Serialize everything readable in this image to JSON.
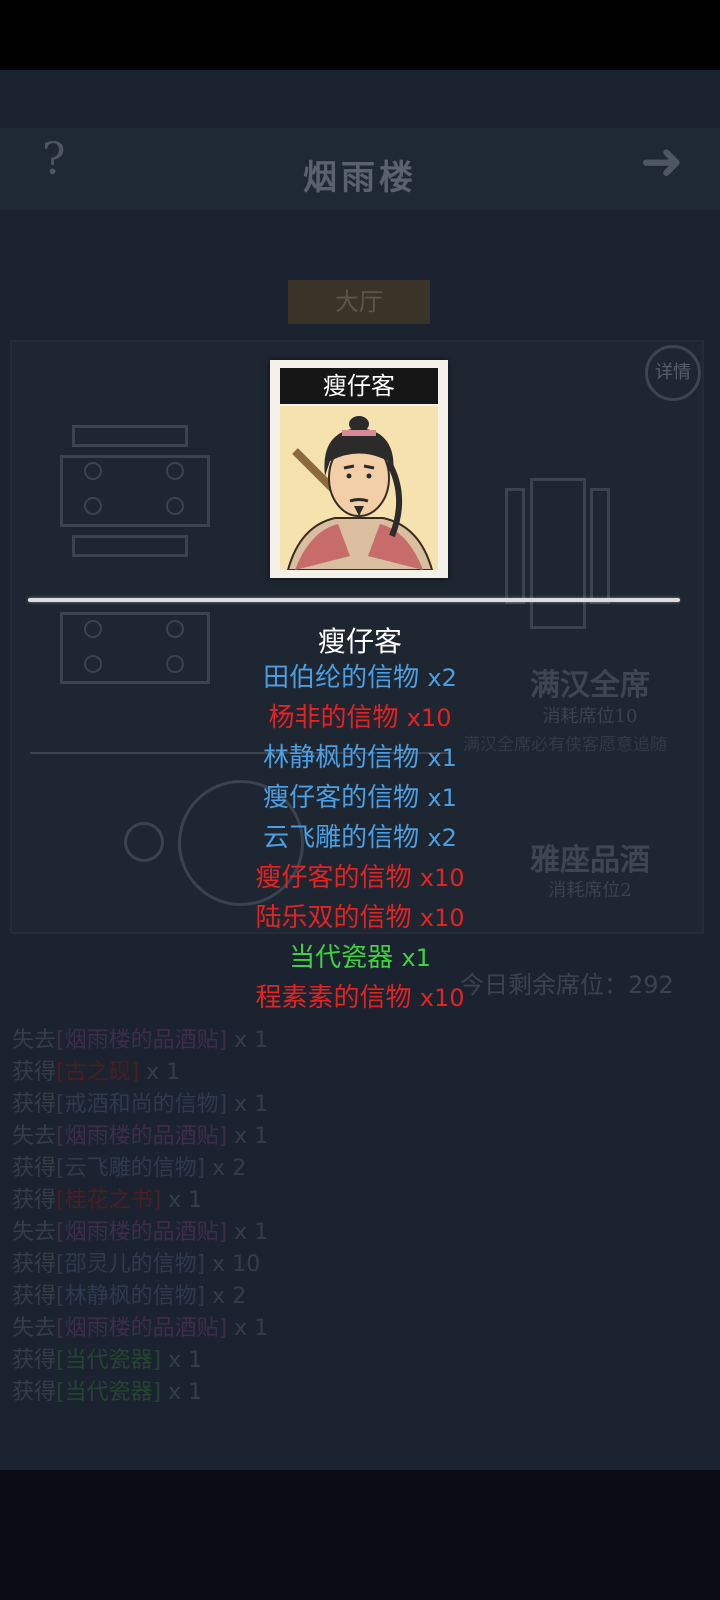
{
  "header": {
    "title": "烟雨楼",
    "help_icon": "?",
    "next_icon": "right-arrow-icon"
  },
  "tab": {
    "label": "大厅"
  },
  "detail": {
    "label": "详情"
  },
  "options": [
    {
      "title": "满汉全席",
      "cost": "消耗席位10",
      "desc": "满汉全席必有侠客愿意追随"
    },
    {
      "title": "雅座品酒",
      "cost": "消耗席位2"
    }
  ],
  "remaining": "今日剩余席位：292",
  "log": [
    {
      "verb": "失去",
      "item": "[烟雨楼的品酒贴]",
      "qty": " x 1",
      "tone": "pur"
    },
    {
      "verb": "获得",
      "item": "[古之砚]",
      "qty": " x 1",
      "tone": "red"
    },
    {
      "verb": "获得",
      "item": "[戒酒和尚的信物]",
      "qty": " x 1",
      "tone": "blue"
    },
    {
      "verb": "失去",
      "item": "[烟雨楼的品酒贴]",
      "qty": " x 1",
      "tone": "pur"
    },
    {
      "verb": "获得",
      "item": "[云飞雕的信物]",
      "qty": " x 2",
      "tone": "blue"
    },
    {
      "verb": "获得",
      "item": "[桂花之书]",
      "qty": " x 1",
      "tone": "red"
    },
    {
      "verb": "失去",
      "item": "[烟雨楼的品酒贴]",
      "qty": " x 1",
      "tone": "pur"
    },
    {
      "verb": "获得",
      "item": "[邵灵儿的信物]",
      "qty": " x 10",
      "tone": "blue"
    },
    {
      "verb": "获得",
      "item": "[林静枫的信物]",
      "qty": " x 2",
      "tone": "blue"
    },
    {
      "verb": "失去",
      "item": "[烟雨楼的品酒贴]",
      "qty": " x 1",
      "tone": "pur"
    },
    {
      "verb": "获得",
      "item": "[当代瓷器]",
      "qty": " x 1",
      "tone": "grn"
    },
    {
      "verb": "获得",
      "item": "[当代瓷器]",
      "qty": " x 1",
      "tone": "grn"
    }
  ],
  "popup": {
    "card_name": "瘦仔客",
    "title": "瘦仔客",
    "colors": {
      "blue": "#4a9fe3",
      "red": "#e52222",
      "green": "#3fd13f"
    },
    "rewards": [
      {
        "name": "田伯纶的信物",
        "qty": "x2",
        "color": "blue"
      },
      {
        "name": "杨非的信物",
        "qty": "x10",
        "color": "red"
      },
      {
        "name": "林静枫的信物",
        "qty": "x1",
        "color": "blue"
      },
      {
        "name": "瘦仔客的信物",
        "qty": "x1",
        "color": "blue"
      },
      {
        "name": "云飞雕的信物",
        "qty": "x2",
        "color": "blue"
      },
      {
        "name": "瘦仔客的信物",
        "qty": "x10",
        "color": "red"
      },
      {
        "name": "陆乐双的信物",
        "qty": "x10",
        "color": "red"
      },
      {
        "name": "当代瓷器",
        "qty": "x1",
        "color": "green"
      },
      {
        "name": "程素素的信物",
        "qty": "x10",
        "color": "red"
      }
    ]
  }
}
